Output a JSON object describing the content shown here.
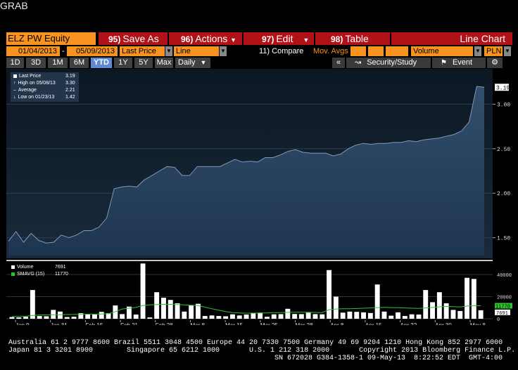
{
  "window": {
    "title": "GRAB"
  },
  "toolbar": {
    "ticker": "ELZ PW Equity",
    "save_num": "95)",
    "save_label": "Save As",
    "actions_num": "96)",
    "actions_label": "Actions",
    "edit_num": "97)",
    "edit_label": "Edit",
    "table_num": "98)",
    "table_label": "Table",
    "chart_type": "Line Chart"
  },
  "params": {
    "start_date": "01/04/2013",
    "end_date": "05/09/2013",
    "field": "Last Price",
    "style": "Line",
    "compare": "11) Compare",
    "mov_avgs": "Mov. Avgs",
    "volume": "Volume",
    "currency": "PLN",
    "dash": "-"
  },
  "ranges": {
    "items": [
      "1D",
      "3D",
      "1M",
      "6M",
      "YTD",
      "1Y",
      "5Y",
      "Max"
    ],
    "selected": "YTD",
    "period": "Daily",
    "security_study": "Security/Study",
    "event": "Event"
  },
  "price_legend": {
    "last_label": "Last Price",
    "last_value": "3.19",
    "high_label": "High on 05/08/13",
    "high_value": "3.30",
    "avg_label": "Average",
    "avg_value": "2.21",
    "low_label": "Low on 01/23/13",
    "low_value": "1.42"
  },
  "volume_legend": {
    "vol_label": "Volume",
    "vol_value": "7691",
    "smavg_label": "SMAVG (15)",
    "smavg_value": "11770"
  },
  "colors": {
    "accent_red": "#b01218",
    "orange": "#f7931e",
    "area": "#2a4763",
    "volume_bar": "#ffffff",
    "smavg_line": "#2fc22f"
  },
  "chart_data": [
    {
      "type": "area",
      "title": "",
      "ylim": [
        1.3,
        3.35
      ],
      "y_ticks": [
        "1.50",
        "2.00",
        "2.50",
        "3.00"
      ],
      "last_label": "3.19",
      "values": [
        1.46,
        1.57,
        1.45,
        1.55,
        1.47,
        1.44,
        1.45,
        1.53,
        1.5,
        1.53,
        1.58,
        1.58,
        1.62,
        1.72,
        2.05,
        2.07,
        2.08,
        2.07,
        2.15,
        2.2,
        2.25,
        2.3,
        2.29,
        2.2,
        2.2,
        2.3,
        2.3,
        2.3,
        2.3,
        2.34,
        2.38,
        2.35,
        2.36,
        2.35,
        2.4,
        2.4,
        2.43,
        2.47,
        2.49,
        2.46,
        2.45,
        2.45,
        2.45,
        2.42,
        2.44,
        2.5,
        2.54,
        2.56,
        2.55,
        2.56,
        2.56,
        2.57,
        2.57,
        2.59,
        2.58,
        2.6,
        2.61,
        2.62,
        2.64,
        2.66,
        2.7,
        2.8,
        3.2,
        3.19
      ]
    },
    {
      "type": "bar",
      "ylim": [
        0,
        47000
      ],
      "y_ticks": [
        "0",
        "20000",
        "40000"
      ],
      "last_volume_label": "7691",
      "smavg_label": "11770",
      "x_tick_labels": [
        "Jan 9",
        "Jan 31",
        "Feb 15",
        "Feb 21",
        "Feb 28",
        "Mar 8",
        "Mar 15",
        "Mar 25",
        "Mar 28",
        "Apr 8",
        "Apr 15",
        "Apr 22",
        "Apr 30",
        "May 8"
      ],
      "x_year": "2013",
      "values": [
        1500,
        1200,
        1800,
        26000,
        2500,
        2200,
        8000,
        6500,
        1500,
        1800,
        5000,
        4000,
        3800,
        6200,
        5000,
        12000,
        4200,
        11000,
        3800,
        50000,
        1200,
        24000,
        19000,
        17000,
        14000,
        6500,
        12000,
        13500,
        2500,
        3000,
        2500,
        2200,
        4000,
        3000,
        3800,
        5200,
        5500,
        1800,
        4000,
        4200,
        9000,
        4300,
        4200,
        5500,
        4200,
        4000,
        44000,
        20000,
        5500,
        6500,
        6200,
        5800,
        5200,
        31000,
        6500,
        2800,
        5800,
        2500,
        4000,
        3800,
        26000,
        15000,
        24000,
        14000,
        8000,
        7000,
        37000,
        36000,
        7691
      ],
      "smavg": [
        2000,
        2100,
        2200,
        3000,
        3400,
        3500,
        3600,
        3700,
        3800,
        3900,
        4000,
        4100,
        4200,
        4300,
        4500,
        6500,
        8800,
        9500,
        10200,
        12000,
        12500,
        12800,
        13000,
        13000,
        12800,
        12500,
        12200,
        11900,
        10500,
        9000,
        7800,
        6500,
        5500,
        5200,
        5000,
        5100,
        5200,
        5300,
        5500,
        5600,
        5800,
        5900,
        6000,
        5900,
        5700,
        5600,
        8200,
        8800,
        9000,
        9100,
        9300,
        9500,
        9800,
        10100,
        10300,
        10100,
        10000,
        9800,
        9500,
        9400,
        9800,
        10200,
        10800,
        11200,
        11000,
        10600,
        11500,
        11800,
        11770
      ]
    }
  ],
  "footer": {
    "line1": "Australia 61 2 9777 8600 Brazil 5511 3048 4500 Europe 44 20 7330 7500 Germany 49 69 9204 1210 Hong Kong 852 2977 6000",
    "line2": "Japan 81 3 3201 8900        Singapore 65 6212 1000       U.S. 1 212 318 2000       Copyright 2013 Bloomberg Finance L.P.",
    "line3": "SN 672028 G384-1358-1 09-May-13  8:22:52 EDT  GMT-4:00"
  }
}
